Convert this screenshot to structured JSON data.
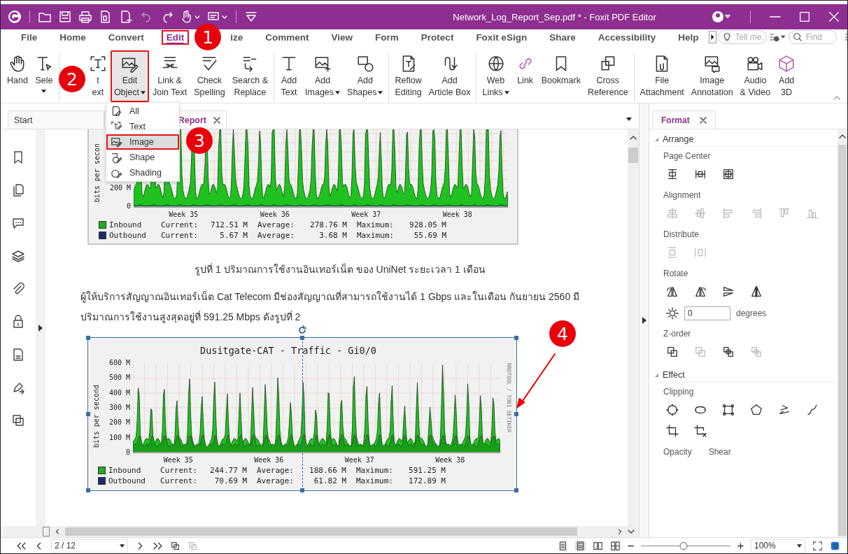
{
  "window": {
    "title": "Network_Log_Report_Sep.pdf * - Foxit PDF Editor"
  },
  "menu_tabs": [
    {
      "label": "File",
      "selected": false,
      "highlighted": false
    },
    {
      "label": "Home",
      "selected": false,
      "highlighted": false
    },
    {
      "label": "Convert",
      "selected": false,
      "highlighted": false
    },
    {
      "label": "Edit",
      "selected": true,
      "highlighted": true,
      "callout": "1"
    },
    {
      "label": "ize",
      "selected": false,
      "highlighted": false
    },
    {
      "label": "Comment",
      "selected": false,
      "highlighted": false
    },
    {
      "label": "View",
      "selected": false,
      "highlighted": false
    },
    {
      "label": "Form",
      "selected": false,
      "highlighted": false
    },
    {
      "label": "Protect",
      "selected": false,
      "highlighted": false
    },
    {
      "label": "Foxit eSign",
      "selected": false,
      "highlighted": false
    },
    {
      "label": "Share",
      "selected": false,
      "highlighted": false
    },
    {
      "label": "Accessibility",
      "selected": false,
      "highlighted": false
    },
    {
      "label": "Help",
      "selected": false,
      "highlighted": false
    }
  ],
  "tell_me": {
    "placeholder": "Tell me."
  },
  "find": {
    "placeholder": "Find"
  },
  "ribbon": {
    "groups": [
      {
        "items": [
          {
            "lines": [
              "Hand"
            ],
            "dropdown": false,
            "selected": false,
            "highlighted": false
          },
          {
            "lines": [
              "Sele"
            ],
            "dropdown": true,
            "selected": false,
            "highlighted": false
          }
        ]
      },
      {
        "callout": "2",
        "items": [
          {
            "lines": [
              "t",
              "ext"
            ],
            "dropdown": false,
            "selected": false,
            "highlighted": false
          },
          {
            "lines": [
              "Edit",
              "Object"
            ],
            "dropdown": true,
            "selected": true,
            "highlighted": true
          },
          {
            "lines": [
              "Link &",
              "Join Text"
            ],
            "dropdown": false,
            "selected": false,
            "highlighted": false
          },
          {
            "lines": [
              "Check",
              "Spelling"
            ],
            "dropdown": false,
            "selected": false,
            "highlighted": false
          },
          {
            "lines": [
              "Search &",
              "Replace"
            ],
            "dropdown": false,
            "selected": false,
            "highlighted": false
          }
        ]
      },
      {
        "items": [
          {
            "lines": [
              "Add",
              "Text"
            ],
            "dropdown": false,
            "selected": false,
            "highlighted": false
          },
          {
            "lines": [
              "Add",
              "Images"
            ],
            "dropdown": true,
            "selected": false,
            "highlighted": false
          },
          {
            "lines": [
              "Add",
              "Shapes"
            ],
            "dropdown": true,
            "selected": false,
            "highlighted": false
          }
        ]
      },
      {
        "items": [
          {
            "lines": [
              "Reflow",
              "Editing"
            ],
            "dropdown": false,
            "selected": false,
            "highlighted": false
          },
          {
            "lines": [
              "Add",
              "Article Box"
            ],
            "dropdown": false,
            "selected": false,
            "highlighted": false
          }
        ]
      },
      {
        "items": [
          {
            "lines": [
              "Web",
              "Links"
            ],
            "dropdown": true,
            "selected": false,
            "highlighted": false
          },
          {
            "lines": [
              "Link"
            ],
            "dropdown": false,
            "selected": false,
            "highlighted": false
          },
          {
            "lines": [
              "Bookmark"
            ],
            "dropdown": false,
            "selected": false,
            "highlighted": false
          },
          {
            "lines": [
              "Cross",
              "Reference"
            ],
            "dropdown": false,
            "selected": false,
            "highlighted": false
          }
        ]
      },
      {
        "items": [
          {
            "lines": [
              "File",
              "Attachment"
            ],
            "dropdown": false,
            "selected": false,
            "highlighted": false
          },
          {
            "lines": [
              "Image",
              "Annotation"
            ],
            "dropdown": false,
            "selected": false,
            "highlighted": false
          },
          {
            "lines": [
              "Audio",
              "& Video"
            ],
            "dropdown": false,
            "selected": false,
            "highlighted": false
          },
          {
            "lines": [
              "Add",
              "3D"
            ],
            "dropdown": false,
            "selected": false,
            "highlighted": false
          }
        ]
      }
    ]
  },
  "edit_object_menu": [
    {
      "label": "All",
      "selected": false
    },
    {
      "label": "Text",
      "selected": false
    },
    {
      "label": "Image",
      "selected": true,
      "callout": "3"
    },
    {
      "label": "Shape",
      "selected": false
    },
    {
      "label": "Shading",
      "selected": false
    }
  ],
  "doc_tabs": [
    {
      "label": "Start",
      "selected": false,
      "closable": false
    },
    {
      "label": "Report",
      "selected": true,
      "closable": true
    }
  ],
  "document": {
    "chart_1": {
      "y_label": "bits per secon",
      "y_ticks": [
        "200 M",
        "0"
      ],
      "x_labels": [
        "Week 35",
        "Week 36",
        "Week 37",
        "Week 38"
      ],
      "legend": [
        {
          "color": "#1fae1f",
          "cells": [
            "Inbound",
            "Current:",
            "712.51 M",
            "Average:",
            "278.76 M",
            "Maximum:",
            "928.05 M"
          ]
        },
        {
          "color": "#1c2a6e",
          "cells": [
            "Outbound",
            "Current:",
            "5.67 M",
            "Average:",
            "3.68 M",
            "Maximum:",
            "55.69 M"
          ]
        }
      ]
    },
    "caption": "รูปที่ 1 ปริมาณการใช้งานอินเทอร์เน็ต ของ UniNet ระยะเวลา 1 เดือน",
    "paragraph": "ผู้ให้บริการสัญญาณอินเทอร์เน็ต Cat Telecom มีช่องสัญญาณที่สามารถใช้งานได้ 1 Gbps และในเดือน กันยายน 2560 มีปริมาณการใช้งานสูงสุดอยู่ที่ 591.25 Mbps ดังรูปที่ 2",
    "chart_2": {
      "selected": true,
      "callout": "4",
      "title": "Dusitgate-CAT - Traffic - Gi0/0",
      "y_label": "bits per second",
      "y_ticks": [
        "600 M",
        "500 M",
        "400 M",
        "300 M",
        "200 M",
        "100 M",
        "0"
      ],
      "x_labels": [
        "Week 35",
        "Week 36",
        "Week 37",
        "Week 38"
      ],
      "side_text": "RRDTOOL / TOBI OETIKER",
      "legend": [
        {
          "color": "#1fae1f",
          "cells": [
            "Inbound",
            "Current:",
            "244.77 M",
            "Average:",
            "188.66 M",
            "Maximum:",
            "591.25 M"
          ]
        },
        {
          "color": "#1c2a6e",
          "cells": [
            "Outbound",
            "Current:",
            "70.69 M",
            "Average:",
            "61.82 M",
            "Maximum:",
            "172.89 M"
          ]
        }
      ]
    }
  },
  "format_panel": {
    "tab": "Format",
    "sections": [
      {
        "title": "Arrange",
        "expanded": true,
        "groups": [
          {
            "kind": "icons",
            "label": "Page Center",
            "icons": [
              {
                "disabled": false
              },
              {
                "disabled": false
              },
              {
                "disabled": false
              }
            ]
          },
          {
            "kind": "icons",
            "label": "Alignment",
            "icons": [
              {
                "disabled": true
              },
              {
                "disabled": true
              },
              {
                "disabled": true
              },
              {
                "disabled": true
              },
              {
                "disabled": true
              },
              {
                "disabled": true
              }
            ]
          },
          {
            "kind": "icons",
            "label": "Distribute",
            "icons": [
              {
                "disabled": true
              },
              {
                "disabled": true
              }
            ]
          },
          {
            "kind": "icons",
            "label": "Rotate",
            "icons": [
              {
                "disabled": false
              },
              {
                "disabled": false
              },
              {
                "disabled": false
              },
              {
                "disabled": false
              }
            ]
          },
          {
            "kind": "field",
            "value": "0",
            "unit": "degrees"
          },
          {
            "kind": "icons",
            "label": "Z-order",
            "icons": [
              {
                "disabled": false
              },
              {
                "disabled": true
              },
              {
                "disabled": false
              },
              {
                "disabled": true
              }
            ]
          }
        ]
      },
      {
        "title": "Effect",
        "expanded": true,
        "groups": [
          {
            "kind": "icons",
            "label": "Clipping",
            "icons": [
              {
                "disabled": false
              },
              {
                "disabled": false
              },
              {
                "disabled": false
              },
              {
                "disabled": false
              },
              {
                "disabled": false
              },
              {
                "disabled": false
              }
            ]
          },
          {
            "kind": "icons",
            "icons": [
              {
                "disabled": false
              },
              {
                "disabled": false
              }
            ]
          },
          {
            "kind": "labels",
            "labels": [
              "Opacity",
              "Shear"
            ]
          }
        ]
      }
    ]
  },
  "status_bar": {
    "page": "2 / 12",
    "zoom": "100%",
    "zoom_level": {
      "level": 0.48
    }
  }
}
